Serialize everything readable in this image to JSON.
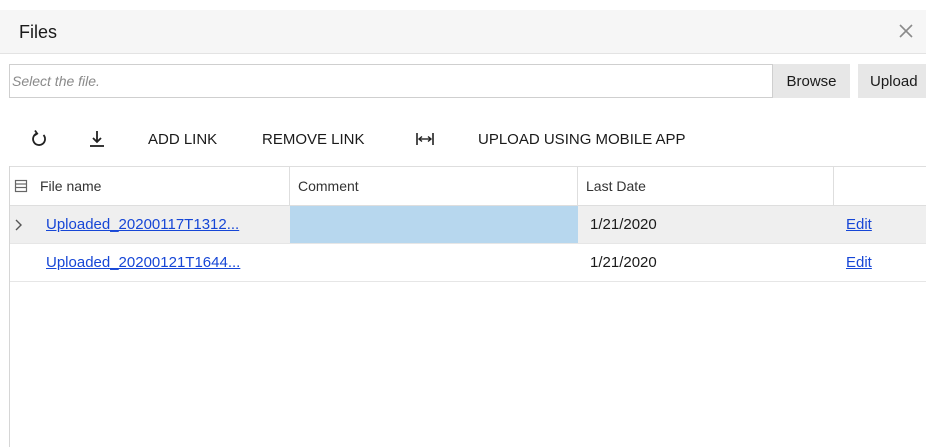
{
  "dialog": {
    "title": "Files",
    "close_icon": "close-icon"
  },
  "file_picker": {
    "placeholder": "Select the file.",
    "browse_label": "Browse",
    "upload_label": "Upload"
  },
  "toolbar": {
    "refresh_icon": "refresh-icon",
    "download_icon": "download-icon",
    "add_link_label": "ADD LINK",
    "remove_link_label": "REMOVE LINK",
    "fit_width_icon": "fit-columns-icon",
    "upload_mobile_label": "UPLOAD USING MOBILE APP"
  },
  "grid": {
    "columns": {
      "file_name": "File name",
      "comment": "Comment",
      "last_date": "Last Date"
    },
    "rows": [
      {
        "file_name": "Uploaded_20200117T1312...",
        "comment": "",
        "last_date": "1/21/2020",
        "action": "Edit",
        "selected": true
      },
      {
        "file_name": "Uploaded_20200121T1644...",
        "comment": "",
        "last_date": "1/21/2020",
        "action": "Edit",
        "selected": false
      }
    ]
  },
  "colors": {
    "link": "#1646d6",
    "selected_cell": "#b7d7ee",
    "selected_row": "#efefef",
    "button_bg": "#e7e7e7"
  }
}
